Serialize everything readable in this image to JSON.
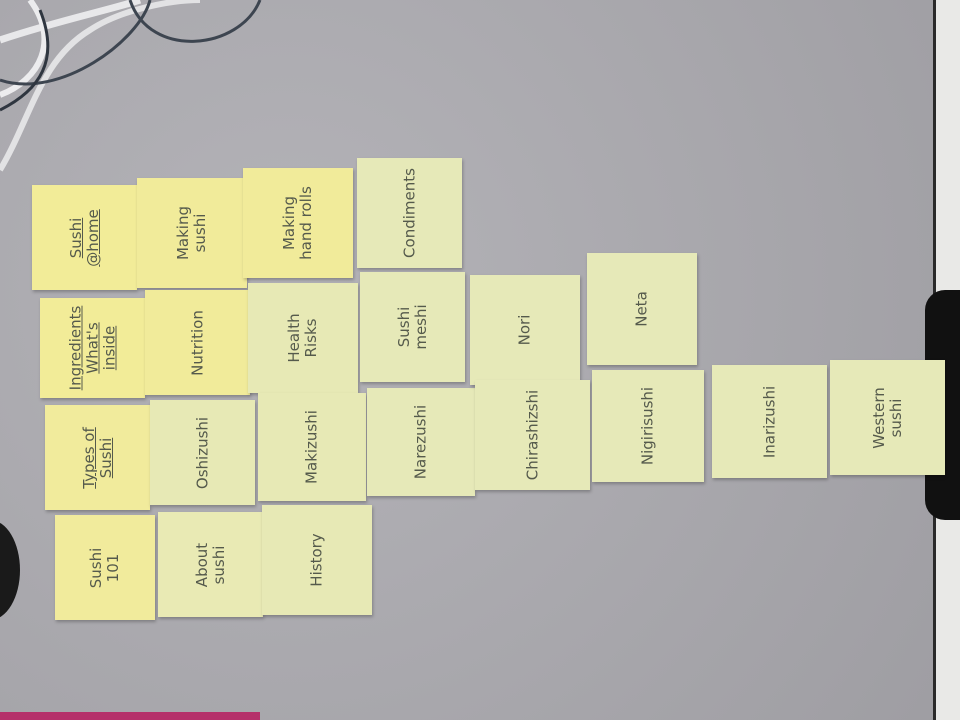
{
  "notes": [
    {
      "label": "Sushi\n@home",
      "color": "#f2ec98"
    },
    {
      "label": "Ingredients\nWhat's inside",
      "color": "#f2ec98"
    },
    {
      "label": "Types of\nSushi",
      "color": "#f1eb9c"
    },
    {
      "label": "Sushi\n101",
      "color": "#f1eb9c"
    },
    {
      "label": "Making\nsushi",
      "color": "#f1eb9a"
    },
    {
      "label": "Nutrition",
      "color": "#f1eb9a"
    },
    {
      "label": "Oshizushi",
      "color": "#e7e9b5"
    },
    {
      "label": "About\nsushi",
      "color": "#e9eab4"
    },
    {
      "label": "Making\nhand rolls",
      "color": "#f1eb9a"
    },
    {
      "label": "Health\nRisks",
      "color": "#e7e9b5"
    },
    {
      "label": "Makizushi",
      "color": "#e7e9b5"
    },
    {
      "label": "History",
      "color": "#e7e9b5"
    },
    {
      "label": "Condiments",
      "color": "#e6e9b8"
    },
    {
      "label": "Sushi\nmeshi",
      "color": "#e6e9b8"
    },
    {
      "label": "Narezushi",
      "color": "#e6e9b8"
    },
    {
      "label": "Nori",
      "color": "#e6e9b8"
    },
    {
      "label": "Chirashizshi",
      "color": "#e6e9b8"
    },
    {
      "label": "Neta",
      "color": "#e6e9b8"
    },
    {
      "label": "Nigirisushi",
      "color": "#e6e9b8"
    },
    {
      "label": "Inarizushi",
      "color": "#e6e9b8"
    },
    {
      "label": "Western\nsushi",
      "color": "#e6e9b8"
    }
  ]
}
